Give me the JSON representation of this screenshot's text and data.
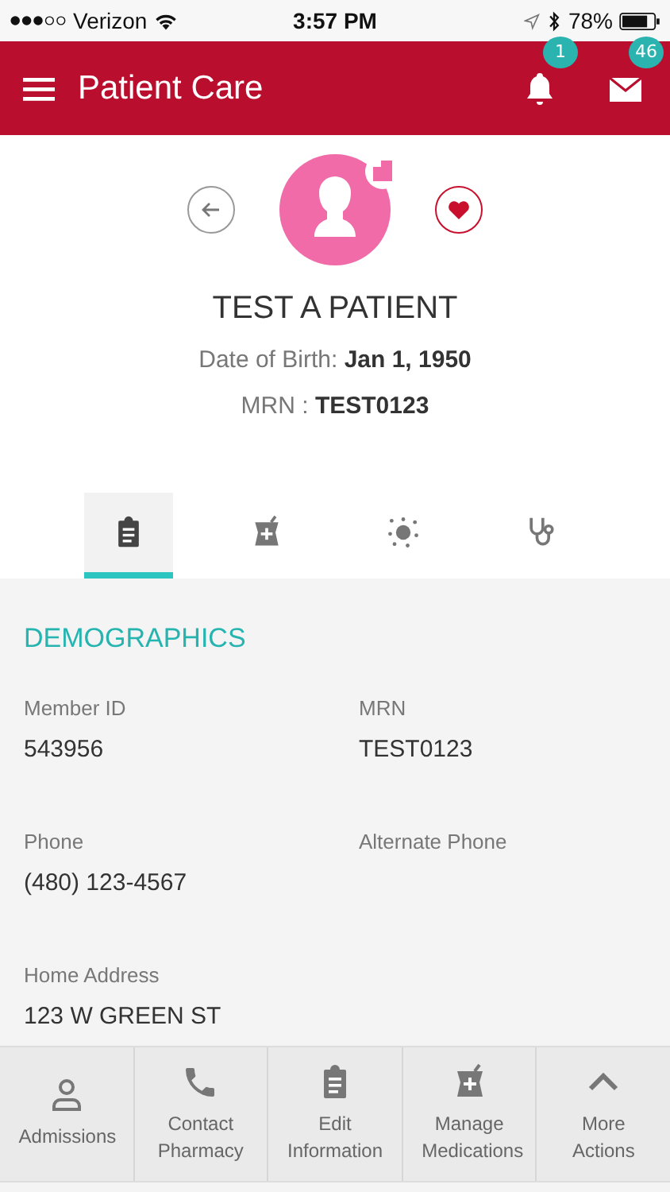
{
  "status_bar": {
    "carrier": "Verizon",
    "time": "3:57 PM",
    "battery": "78%"
  },
  "header": {
    "title": "Patient Care",
    "notifications_badge": "1",
    "messages_badge": "46"
  },
  "patient": {
    "name": "TEST A PATIENT",
    "dob_label": "Date of Birth:",
    "dob": "Jan 1, 1950",
    "mrn_label": "MRN :",
    "mrn": "TEST0123"
  },
  "tabs": [
    {
      "kind": "clipboard",
      "selected": true
    },
    {
      "kind": "pharmacy",
      "selected": false
    },
    {
      "kind": "virus",
      "selected": false
    },
    {
      "kind": "stethoscope",
      "selected": false
    }
  ],
  "section_title": "DEMOGRAPHICS",
  "fields": [
    {
      "label": "Member ID",
      "value": "543956"
    },
    {
      "label": "MRN",
      "value": "TEST0123"
    },
    {
      "label": "Phone",
      "value": "(480) 123-4567"
    },
    {
      "label": "Alternate Phone"
    },
    {
      "label": "Home Address",
      "value": "123 W GREEN ST"
    }
  ],
  "actions": [
    {
      "kind": "person",
      "label": "Admissions"
    },
    {
      "kind": "phone",
      "label": "Contact Pharmacy"
    },
    {
      "kind": "clipboard",
      "label": "Edit Information"
    },
    {
      "kind": "pharmacy",
      "label": "Manage Medications"
    },
    {
      "kind": "chevron",
      "label": "More Actions"
    }
  ]
}
